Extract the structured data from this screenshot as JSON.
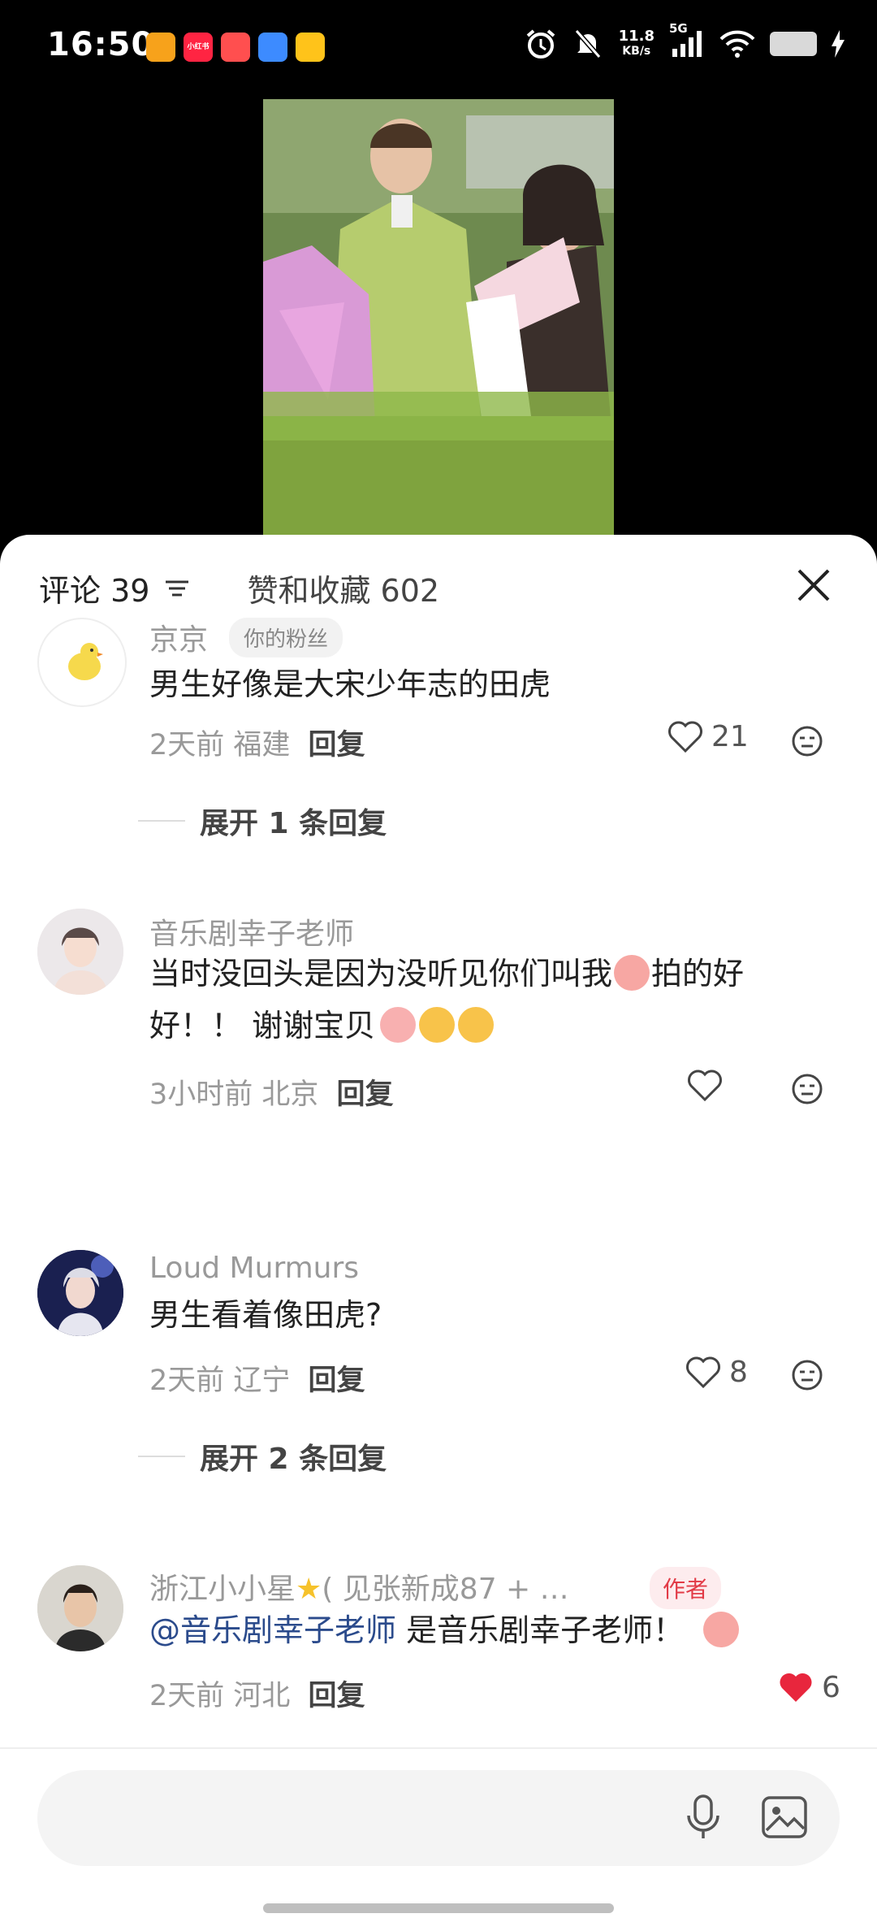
{
  "status": {
    "time": "16:50",
    "net_speed_value": "11.8",
    "net_speed_unit": "KB/s",
    "network": "5G",
    "app_badge": "小红书"
  },
  "sheet": {
    "comments_tab": "评论 39",
    "likes_tab": "赞和收藏 602"
  },
  "comments": [
    {
      "user": "京京",
      "badge": "你的粉丝",
      "text": "男生好像是大宋少年志的田虎",
      "time": "2天前",
      "location": "福建",
      "reply": "回复",
      "likes": "21",
      "expand": "展开 1 条回复"
    },
    {
      "user": "音乐剧幸子老师",
      "text_a": "当时没回头是因为没听见你们叫我",
      "text_b": "拍的好好！！ 谢谢宝贝",
      "time": "3小时前",
      "location": "北京",
      "reply": "回复"
    },
    {
      "user": "Loud Murmurs",
      "text": "男生看着像田虎?",
      "time": "2天前",
      "location": "辽宁",
      "reply": "回复",
      "likes": "8",
      "expand": "展开 2 条回复"
    },
    {
      "user": "浙江小小星",
      "user_suffix": "( 见张新成87 + …",
      "badge": "作者",
      "mention": "@音乐剧幸子老师",
      "text": " 是音乐剧幸子老师！",
      "time": "2天前",
      "location": "河北",
      "reply": "回复",
      "likes": "6"
    }
  ],
  "colors": {
    "sheet_bg": "#ffffff",
    "liked_red": "#e8263d",
    "mention_blue": "#2b4b8c",
    "author_badge_red": "#e23b47"
  }
}
